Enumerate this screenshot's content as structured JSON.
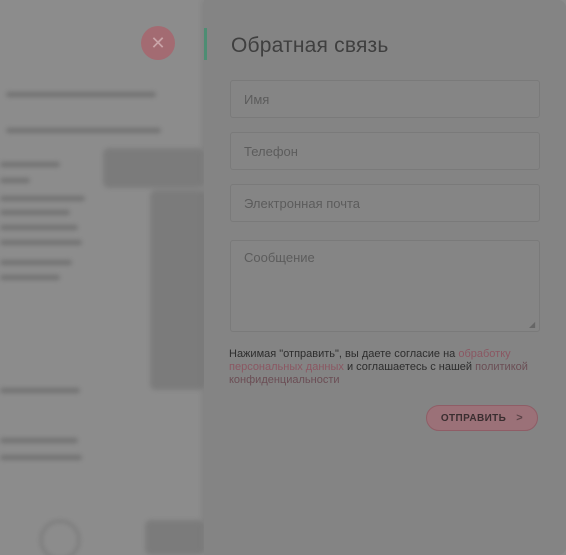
{
  "modal": {
    "title": "Обратная связь",
    "fields": {
      "name_placeholder": "Имя",
      "phone_placeholder": "Телефон",
      "email_placeholder": "Электронная почта",
      "message_placeholder": "Сообщение"
    },
    "consent": {
      "prefix": "Нажимая \"отправить\", вы даете согласие на ",
      "link1": "обработку персональных данных",
      "middle": " и соглашаетесь c нашей ",
      "link2": "политикой конфиденциальности"
    },
    "submit_label": "ОТПРАВИТЬ",
    "submit_arrow": ">",
    "close_glyph": "✕"
  },
  "colors": {
    "accent": "#4e8d73",
    "primary_button": "#9b7178",
    "overlay": "#848484"
  }
}
